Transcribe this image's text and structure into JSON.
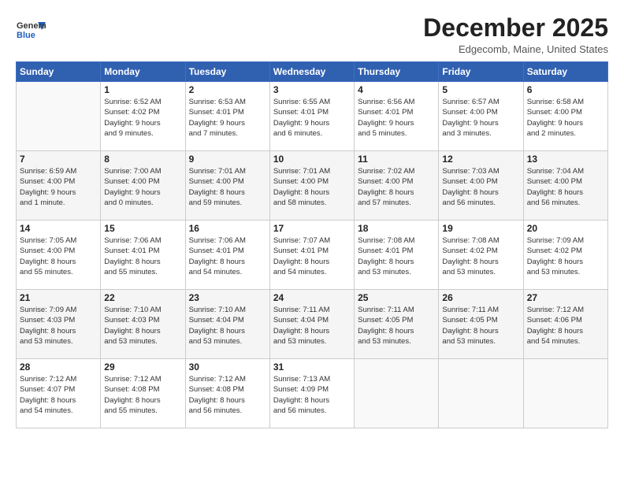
{
  "header": {
    "logo_general": "General",
    "logo_blue": "Blue",
    "title": "December 2025",
    "location": "Edgecomb, Maine, United States"
  },
  "days_of_week": [
    "Sunday",
    "Monday",
    "Tuesday",
    "Wednesday",
    "Thursday",
    "Friday",
    "Saturday"
  ],
  "weeks": [
    [
      {
        "day": "",
        "info": ""
      },
      {
        "day": "1",
        "info": "Sunrise: 6:52 AM\nSunset: 4:02 PM\nDaylight: 9 hours\nand 9 minutes."
      },
      {
        "day": "2",
        "info": "Sunrise: 6:53 AM\nSunset: 4:01 PM\nDaylight: 9 hours\nand 7 minutes."
      },
      {
        "day": "3",
        "info": "Sunrise: 6:55 AM\nSunset: 4:01 PM\nDaylight: 9 hours\nand 6 minutes."
      },
      {
        "day": "4",
        "info": "Sunrise: 6:56 AM\nSunset: 4:01 PM\nDaylight: 9 hours\nand 5 minutes."
      },
      {
        "day": "5",
        "info": "Sunrise: 6:57 AM\nSunset: 4:00 PM\nDaylight: 9 hours\nand 3 minutes."
      },
      {
        "day": "6",
        "info": "Sunrise: 6:58 AM\nSunset: 4:00 PM\nDaylight: 9 hours\nand 2 minutes."
      }
    ],
    [
      {
        "day": "7",
        "info": "Sunrise: 6:59 AM\nSunset: 4:00 PM\nDaylight: 9 hours\nand 1 minute."
      },
      {
        "day": "8",
        "info": "Sunrise: 7:00 AM\nSunset: 4:00 PM\nDaylight: 9 hours\nand 0 minutes."
      },
      {
        "day": "9",
        "info": "Sunrise: 7:01 AM\nSunset: 4:00 PM\nDaylight: 8 hours\nand 59 minutes."
      },
      {
        "day": "10",
        "info": "Sunrise: 7:01 AM\nSunset: 4:00 PM\nDaylight: 8 hours\nand 58 minutes."
      },
      {
        "day": "11",
        "info": "Sunrise: 7:02 AM\nSunset: 4:00 PM\nDaylight: 8 hours\nand 57 minutes."
      },
      {
        "day": "12",
        "info": "Sunrise: 7:03 AM\nSunset: 4:00 PM\nDaylight: 8 hours\nand 56 minutes."
      },
      {
        "day": "13",
        "info": "Sunrise: 7:04 AM\nSunset: 4:00 PM\nDaylight: 8 hours\nand 56 minutes."
      }
    ],
    [
      {
        "day": "14",
        "info": "Sunrise: 7:05 AM\nSunset: 4:00 PM\nDaylight: 8 hours\nand 55 minutes."
      },
      {
        "day": "15",
        "info": "Sunrise: 7:06 AM\nSunset: 4:01 PM\nDaylight: 8 hours\nand 55 minutes."
      },
      {
        "day": "16",
        "info": "Sunrise: 7:06 AM\nSunset: 4:01 PM\nDaylight: 8 hours\nand 54 minutes."
      },
      {
        "day": "17",
        "info": "Sunrise: 7:07 AM\nSunset: 4:01 PM\nDaylight: 8 hours\nand 54 minutes."
      },
      {
        "day": "18",
        "info": "Sunrise: 7:08 AM\nSunset: 4:01 PM\nDaylight: 8 hours\nand 53 minutes."
      },
      {
        "day": "19",
        "info": "Sunrise: 7:08 AM\nSunset: 4:02 PM\nDaylight: 8 hours\nand 53 minutes."
      },
      {
        "day": "20",
        "info": "Sunrise: 7:09 AM\nSunset: 4:02 PM\nDaylight: 8 hours\nand 53 minutes."
      }
    ],
    [
      {
        "day": "21",
        "info": "Sunrise: 7:09 AM\nSunset: 4:03 PM\nDaylight: 8 hours\nand 53 minutes."
      },
      {
        "day": "22",
        "info": "Sunrise: 7:10 AM\nSunset: 4:03 PM\nDaylight: 8 hours\nand 53 minutes."
      },
      {
        "day": "23",
        "info": "Sunrise: 7:10 AM\nSunset: 4:04 PM\nDaylight: 8 hours\nand 53 minutes."
      },
      {
        "day": "24",
        "info": "Sunrise: 7:11 AM\nSunset: 4:04 PM\nDaylight: 8 hours\nand 53 minutes."
      },
      {
        "day": "25",
        "info": "Sunrise: 7:11 AM\nSunset: 4:05 PM\nDaylight: 8 hours\nand 53 minutes."
      },
      {
        "day": "26",
        "info": "Sunrise: 7:11 AM\nSunset: 4:05 PM\nDaylight: 8 hours\nand 53 minutes."
      },
      {
        "day": "27",
        "info": "Sunrise: 7:12 AM\nSunset: 4:06 PM\nDaylight: 8 hours\nand 54 minutes."
      }
    ],
    [
      {
        "day": "28",
        "info": "Sunrise: 7:12 AM\nSunset: 4:07 PM\nDaylight: 8 hours\nand 54 minutes."
      },
      {
        "day": "29",
        "info": "Sunrise: 7:12 AM\nSunset: 4:08 PM\nDaylight: 8 hours\nand 55 minutes."
      },
      {
        "day": "30",
        "info": "Sunrise: 7:12 AM\nSunset: 4:08 PM\nDaylight: 8 hours\nand 56 minutes."
      },
      {
        "day": "31",
        "info": "Sunrise: 7:13 AM\nSunset: 4:09 PM\nDaylight: 8 hours\nand 56 minutes."
      },
      {
        "day": "",
        "info": ""
      },
      {
        "day": "",
        "info": ""
      },
      {
        "day": "",
        "info": ""
      }
    ]
  ]
}
